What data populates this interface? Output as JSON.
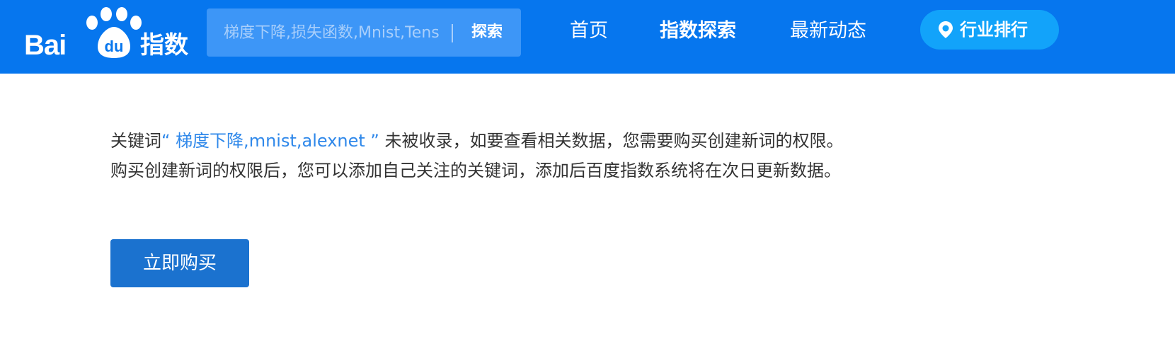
{
  "header": {
    "logo": {
      "latin_text": "Bai",
      "paw_text": "du",
      "cn_text": "指数"
    },
    "search": {
      "placeholder": "梯度下降,损失函数,Mnist,Tens",
      "button_label": "探索"
    },
    "nav": {
      "home": "首页",
      "explore": "指数探索",
      "news": "最新动态"
    },
    "rank_button": {
      "label": "行业排行",
      "icon": "rank-pin-icon"
    }
  },
  "main": {
    "line1_prefix": "关键词",
    "keyword": "“ 梯度下降,mnist,alexnet ”",
    "line1_suffix": "未被收录，如要查看相关数据，您需要购买创建新词的权限。",
    "line2": "购买创建新词的权限后，您可以添加自己关注的关键词，添加后百度指数系统将在次日更新数据。",
    "buy_button_label": "立即购买"
  },
  "colors": {
    "header_bg": "#0676ee",
    "search_bg": "#3d96f7",
    "rank_button_bg": "#12a3fa",
    "keyword_color": "#2f88ea",
    "buy_button_bg": "#1b72cf",
    "text_color": "#333333"
  }
}
